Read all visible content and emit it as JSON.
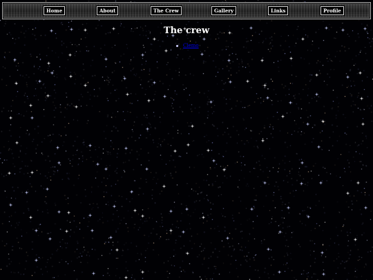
{
  "nav": {
    "items": [
      {
        "label": "Home"
      },
      {
        "label": "About"
      },
      {
        "label": "The Crew"
      },
      {
        "label": "Gallery"
      },
      {
        "label": "Links"
      },
      {
        "label": "Profile"
      }
    ]
  },
  "main": {
    "title": "The crew",
    "crew_links": [
      {
        "label": "Clemo"
      }
    ]
  },
  "colors": {
    "background": "#000000",
    "link": "#0000ee",
    "title": "#ffffff",
    "star": "#ffffff"
  }
}
